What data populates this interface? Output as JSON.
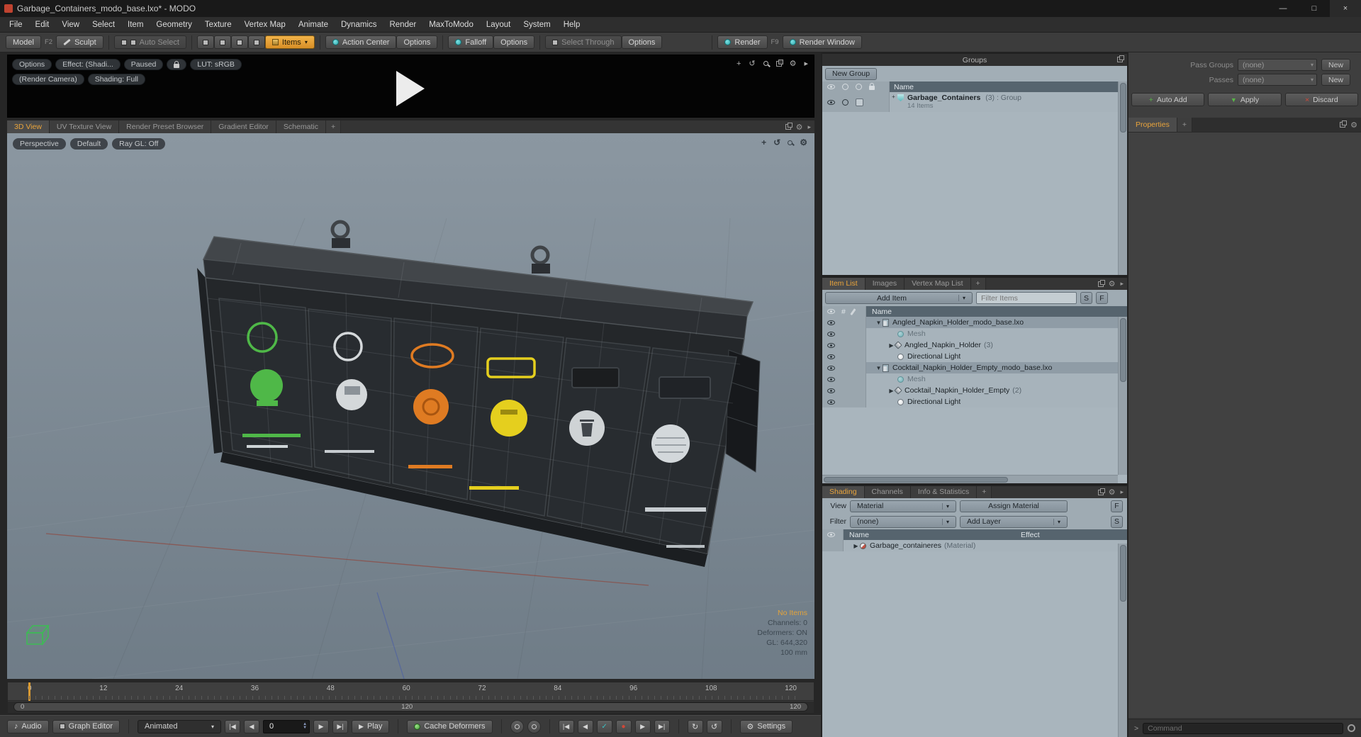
{
  "colors": {
    "accent_orange": "#e9a43c",
    "teal": "#38c2c6",
    "green_bin": "#4fb848",
    "orange_bin": "#df7b22",
    "yellow_bin": "#e5cf1e",
    "red_status": "#d04838",
    "panel_light": "#a9b5bd",
    "viewport_top": "#8b97a1",
    "viewport_bottom": "#6f7c87"
  },
  "icons": {
    "dropdown": "▾",
    "expander_open": "▼",
    "expander_closed": "▶",
    "plus": "+",
    "menu_arrow": "▸",
    "gear": "⚙",
    "rotate": "↺",
    "move": "+",
    "music": "♪",
    "play": "▶",
    "jump_start": "|◀",
    "jump_end": "▶|",
    "step_back": "◀",
    "step_fwd": "▶",
    "check": "✓",
    "record": "●",
    "loop_a": "↻",
    "loop_b": "↺",
    "hash": "#",
    "min": "—",
    "max": "□",
    "close": "×"
  },
  "title_bar": {
    "title": "Garbage_Containers_modo_base.lxo* - MODO"
  },
  "menu": {
    "items": [
      "File",
      "Edit",
      "View",
      "Select",
      "Item",
      "Geometry",
      "Texture",
      "Vertex Map",
      "Animate",
      "Dynamics",
      "Render",
      "MaxToModo",
      "Layout",
      "System",
      "Help"
    ]
  },
  "toolbar": {
    "model": "Model",
    "model_key": "F2",
    "sculpt": "Sculpt",
    "auto_select": "Auto Select",
    "items": "Items",
    "action_center": "Action Center",
    "options_a": "Options",
    "falloff": "Falloff",
    "options_b": "Options",
    "select_through": "Select Through",
    "options_c": "Options",
    "render": "Render",
    "render_key": "F9",
    "render_window": "Render Window"
  },
  "preview": {
    "options": "Options",
    "effect": "Effect: (Shadi...",
    "paused": "Paused",
    "lut": "LUT: sRGB",
    "camera": "(Render Camera)",
    "shading": "Shading: Full"
  },
  "view_tabs": {
    "t0": "3D View",
    "t1": "UV Texture View",
    "t2": "Render Preset Browser",
    "t3": "Gradient Editor",
    "t4": "Schematic",
    "add": "+"
  },
  "viewport": {
    "perspective": "Perspective",
    "default_btn": "Default",
    "raygl": "Ray GL: Off",
    "info": {
      "no_items": "No Items",
      "channels": "Channels: 0",
      "deformers": "Deformers: ON",
      "gl": "GL: 644,320",
      "scale": "100 mm"
    }
  },
  "timeline": {
    "ticks": [
      "0",
      "12",
      "24",
      "36",
      "48",
      "60",
      "72",
      "84",
      "96",
      "108",
      "120"
    ],
    "range_start": "0",
    "range_mid": "120",
    "range_end": "120"
  },
  "transport": {
    "audio": "Audio",
    "graph_editor": "Graph Editor",
    "animated": "Animated",
    "frame": "0",
    "play": "Play",
    "cache_deformers": "Cache Deformers",
    "settings": "Settings"
  },
  "groups_panel": {
    "title": "Groups",
    "new_group": "New Group",
    "name_header": "Name",
    "row": {
      "name": "Garbage_Containers",
      "suffix": "(3) : Group",
      "sub": "14 Items"
    }
  },
  "item_list": {
    "tab_item_list": "Item List",
    "tab_images": "Images",
    "tab_vertex": "Vertex Map List",
    "tab_add": "+",
    "add_item": "Add Item",
    "filter": "Filter Items",
    "s": "S",
    "f": "F",
    "name_header": "Name",
    "rows": [
      {
        "label": "Angled_Napkin_Holder_modo_base.lxo"
      },
      {
        "label": "Mesh"
      },
      {
        "label": "Angled_Napkin_Holder",
        "suffix": "(3)"
      },
      {
        "label": "Directional Light"
      },
      {
        "label": "Cocktail_Napkin_Holder_Empty_modo_base.lxo"
      },
      {
        "label": "Mesh"
      },
      {
        "label": "Cocktail_Napkin_Holder_Empty",
        "suffix": "(2)"
      },
      {
        "label": "Directional Light"
      }
    ]
  },
  "shading": {
    "tab_shading": "Shading",
    "tab_channels": "Channels",
    "tab_info": "Info & Statistics",
    "tab_add": "+",
    "view_label": "View",
    "view_value": "Material",
    "assign_material": "Assign Material",
    "f": "F",
    "filter_label": "Filter",
    "filter_value": "(none)",
    "add_layer": "Add Layer",
    "s": "S",
    "name_header": "Name",
    "effect_header": "Effect",
    "row": {
      "name": "Garbage_containeres",
      "suffix": "(Material)"
    }
  },
  "right_panel": {
    "pass_groups": "Pass Groups",
    "pass_groups_value": "(none)",
    "new_a": "New",
    "passes": "Passes",
    "passes_value": "(none)",
    "new_b": "New",
    "auto_add": "Auto Add",
    "apply": "Apply",
    "discard": "Discard",
    "properties": "Properties",
    "tab_add": "+"
  },
  "command_bar": {
    "prompt": ">",
    "placeholder": "Command"
  }
}
